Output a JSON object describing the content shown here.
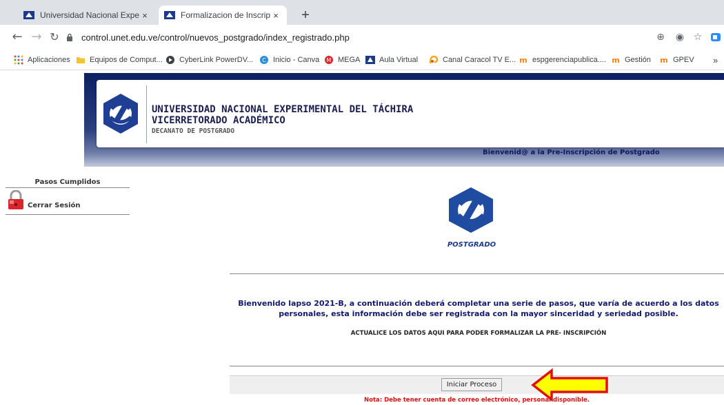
{
  "browser": {
    "tabs": [
      {
        "title": "Universidad Nacional Experiment",
        "active": false
      },
      {
        "title": "Formalizacion de Inscripción",
        "active": true
      }
    ],
    "new_tab": "+",
    "close_glyph": "×",
    "url": "control.unet.edu.ve/control/nuevos_postgrado/index_registrado.php",
    "bookmarks": [
      {
        "label": "Aplicaciones",
        "icon": "apps-grid-icon"
      },
      {
        "label": "Equipos de Comput...",
        "icon": "folder-icon"
      },
      {
        "label": "CyberLink PowerDV...",
        "icon": "cyberlink-icon"
      },
      {
        "label": "Inicio - Canva",
        "icon": "canva-icon"
      },
      {
        "label": "MEGA",
        "icon": "mega-icon"
      },
      {
        "label": "Aula Virtual",
        "icon": "unet-icon"
      },
      {
        "label": "Canal Caracol TV E...",
        "icon": "caracol-icon"
      },
      {
        "label": "espgerenciapublica....",
        "icon": "moodle-icon"
      },
      {
        "label": "Gestión",
        "icon": "moodle-icon"
      },
      {
        "label": "GPEV",
        "icon": "moodle-icon"
      }
    ],
    "more_bookmarks": "»"
  },
  "header": {
    "line1": "UNIVERSIDAD NACIONAL EXPERIMENTAL DEL TÁCHIRA",
    "line2": "VICERRETORADO ACADÉMICO",
    "line3": "DECANATO DE POSTGRADO",
    "welcome": "Bienvenid@ a la Pre-Inscripción de Postgrado",
    "accent_color": "#0b1f64"
  },
  "sidebar": {
    "title": "Pasos Cumplidos",
    "logout_label": "Cerrar Sesión"
  },
  "main": {
    "logo_caption": "POSTGRADO",
    "intro": "Bienvenido lapso 2021-B, a continuación deberá completar una serie de pasos, que varía de acuerdo a los datos personales, esta información debe ser registrada con la mayor sinceridad y seriedad posible.",
    "update_note": "ACTUALICE LOS DATOS AQUI PARA PODER FORMALIZAR LA PRE- INSCRIPCIÓN",
    "start_button": "Iniciar Proceso",
    "footer_note": "Nota: Debe tener cuenta de correo electrónico, personal disponible.",
    "arrow_color": "#ffff00",
    "arrow_outline": "#e01010"
  }
}
